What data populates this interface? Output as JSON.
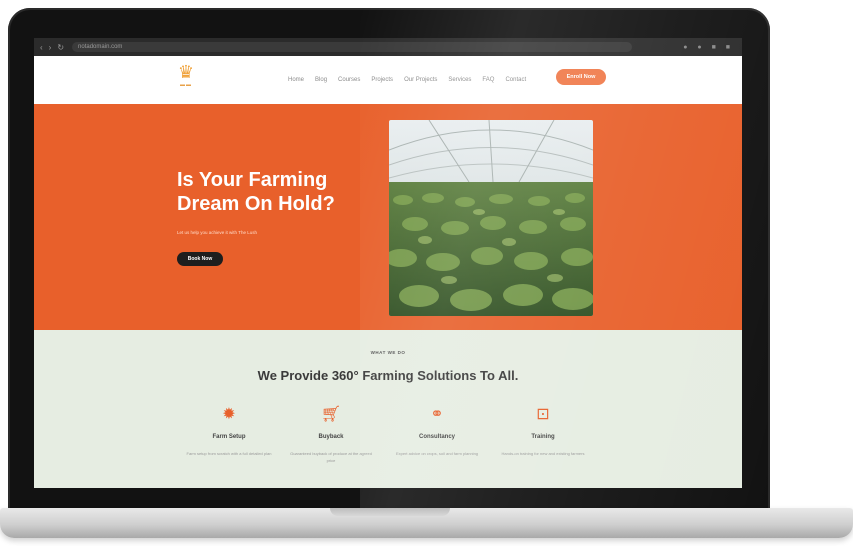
{
  "browser": {
    "url": "notadomain.com"
  },
  "site": {
    "nav": [
      "Home",
      "Blog",
      "Courses",
      "Projects",
      "Our Projects",
      "Services",
      "FAQ",
      "Contact"
    ],
    "nav_cta": "Enroll Now"
  },
  "hero": {
    "title": "Is Your Farming Dream On Hold?",
    "subtitle": "Let us help you achieve it with The Lush",
    "button": "Book Now"
  },
  "services": {
    "kicker": "WHAT WE DO",
    "title": "We Provide 360° Farming Solutions To All.",
    "items": [
      {
        "name": "Farm Setup",
        "icon": "gear-icon",
        "desc": "Farm setup from scratch with a full detailed plan"
      },
      {
        "name": "Buyback",
        "icon": "cart-icon",
        "desc": "Guaranteed buyback of produce at the agreed price"
      },
      {
        "name": "Consultancy",
        "icon": "handshake-icon",
        "desc": "Expert advice on crops, soil and farm planning"
      },
      {
        "name": "Training",
        "icon": "presentation-icon",
        "desc": "Hands-on training for new and existing farmers"
      }
    ]
  },
  "colors": {
    "accent": "#e8602b",
    "cta": "#f07a4a",
    "services_bg": "#e6ede2",
    "dark_button": "#1e1e1e"
  }
}
